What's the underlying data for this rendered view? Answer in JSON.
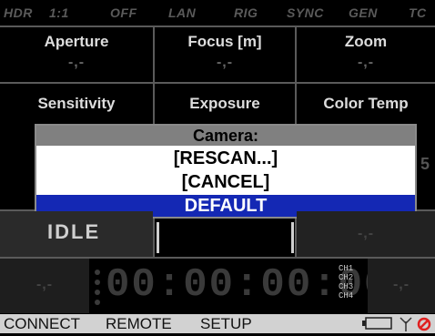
{
  "status_bar": {
    "items": [
      "HDR",
      "1:1",
      "OFF",
      "LAN",
      "RIG",
      "SYNC",
      "GEN",
      "TC"
    ]
  },
  "grid": {
    "row1": [
      {
        "label": "Aperture",
        "value": "-,-"
      },
      {
        "label": "Focus [m]",
        "value": "-,-"
      },
      {
        "label": "Zoom",
        "value": "-,-"
      }
    ],
    "row2": [
      {
        "label": "Sensitivity"
      },
      {
        "label": "Exposure"
      },
      {
        "label": "Color Temp"
      }
    ],
    "right_value": "-,-"
  },
  "dialog": {
    "title": "Camera:",
    "items": [
      "[RESCAN...]",
      "[CANCEL]",
      "DEFAULT"
    ],
    "selected": "DEFAULT"
  },
  "record": {
    "state": "IDLE",
    "left_value": "-,-",
    "right_value": "-,-",
    "timecode": "00:00:00:00",
    "channels": [
      "CH1",
      "CH2",
      "CH3",
      "CH4"
    ]
  },
  "bottom_bar": {
    "tabs": [
      "CONNECT",
      "REMOTE",
      "SETUP"
    ]
  },
  "colors": {
    "selection": "#1428b4",
    "bottom_bar": "#d2d2d2",
    "no_signal": "#e02020"
  },
  "icons": [
    "battery-icon",
    "antenna-icon",
    "no-signal-icon"
  ]
}
